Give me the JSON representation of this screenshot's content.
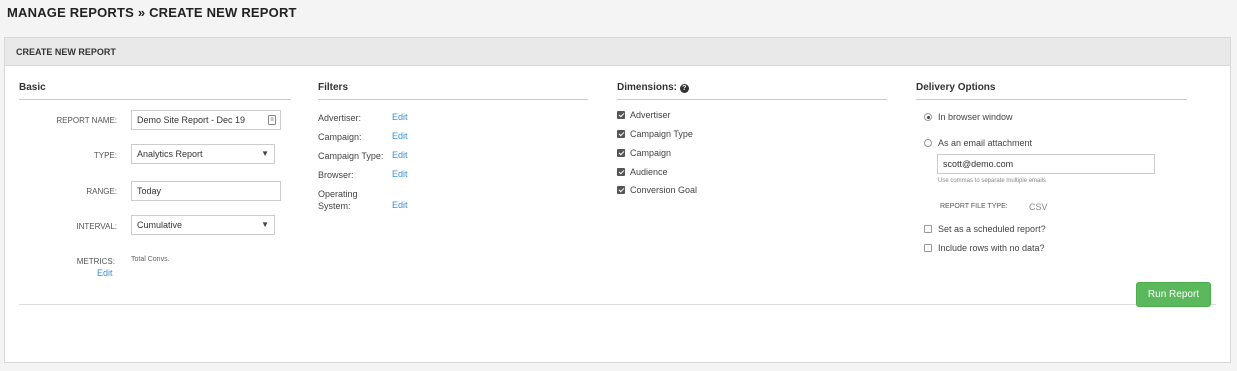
{
  "breadcrumb": "MANAGE REPORTS » CREATE NEW REPORT",
  "panel_title": "CREATE NEW REPORT",
  "basic": {
    "title": "Basic",
    "report_name_label": "REPORT NAME:",
    "report_name_value": "Demo Site Report - Dec 19",
    "type_label": "TYPE:",
    "type_value": "Analytics Report",
    "range_label": "RANGE:",
    "range_value": "Today",
    "interval_label": "INTERVAL:",
    "interval_value": "Cumulative",
    "metrics_label": "METRICS:",
    "metrics_value": "Total Convs.",
    "metrics_edit": "Edit"
  },
  "filters": {
    "title": "Filters",
    "items": [
      {
        "label": "Advertiser:",
        "edit": "Edit"
      },
      {
        "label": "Campaign:",
        "edit": "Edit"
      },
      {
        "label": "Campaign Type:",
        "edit": "Edit"
      },
      {
        "label": "Browser:",
        "edit": "Edit"
      },
      {
        "label": "Operating System:",
        "edit": "Edit"
      }
    ]
  },
  "dimensions": {
    "title": "Dimensions:",
    "help_icon": "question-circle-icon",
    "items": [
      {
        "label": "Advertiser",
        "checked": true
      },
      {
        "label": "Campaign Type",
        "checked": true
      },
      {
        "label": "Campaign",
        "checked": true
      },
      {
        "label": "Audience",
        "checked": true
      },
      {
        "label": "Conversion Goal",
        "checked": true
      }
    ]
  },
  "delivery": {
    "title": "Delivery Options",
    "browser_label": "In browser window",
    "browser_selected": true,
    "email_label": "As an email attachment",
    "email_selected": false,
    "email_value": "scott@demo.com",
    "email_hint": "Use commas to separate multiple emails",
    "file_type_label": "REPORT FILE TYPE:",
    "file_type_value": "CSV",
    "scheduled_label": "Set as a scheduled report?",
    "scheduled_checked": false,
    "no_data_label": "Include rows with no data?",
    "no_data_checked": false
  },
  "run_button": "Run Report",
  "colors": {
    "accent_link": "#3a8fd6",
    "run_button": "#5cb85c"
  }
}
